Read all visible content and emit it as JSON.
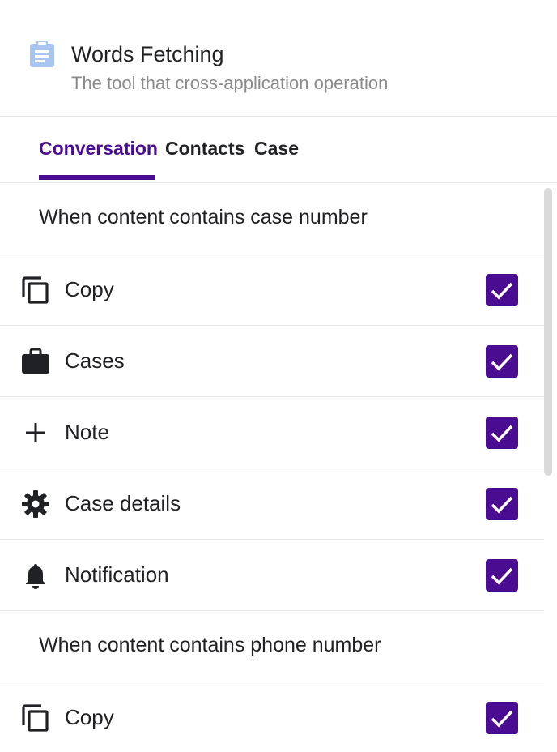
{
  "header": {
    "title": "Words Fetching",
    "subtitle": "The tool that cross-application operation",
    "icon": "clipboard-icon",
    "icon_color": "#a9c6f3"
  },
  "tabs": [
    {
      "label": "Conversation",
      "active": true
    },
    {
      "label": "Contacts",
      "active": false
    },
    {
      "label": "Case",
      "active": false
    }
  ],
  "accent_color": "#4a0d91",
  "sections": [
    {
      "label": "When content contains case number",
      "items": [
        {
          "label": "Copy",
          "icon": "copy-icon",
          "checked": true
        },
        {
          "label": "Cases",
          "icon": "briefcase-icon",
          "checked": true
        },
        {
          "label": "Note",
          "icon": "plus-icon",
          "checked": true
        },
        {
          "label": "Case details",
          "icon": "gear-icon",
          "checked": true
        },
        {
          "label": "Notification",
          "icon": "bell-icon",
          "checked": true
        }
      ]
    },
    {
      "label": "When content contains phone number",
      "items": [
        {
          "label": "Copy",
          "icon": "copy-icon",
          "checked": true
        }
      ]
    }
  ]
}
